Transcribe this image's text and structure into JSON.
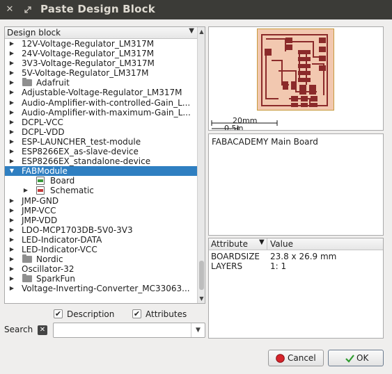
{
  "window": {
    "title": "Paste Design Block",
    "close_glyph": "✕",
    "close_icon": "close-icon",
    "maximize_icon": "maximize-icon"
  },
  "tree": {
    "header": "Design block",
    "items": [
      {
        "label": "12V-Voltage-Regulator_LM317M",
        "kind": "group"
      },
      {
        "label": "24V-Voltage-Regulator_LM317M",
        "kind": "group"
      },
      {
        "label": "3V3-Voltage-Regulator_LM317M",
        "kind": "group"
      },
      {
        "label": "5V-Voltage-Regulator_LM317M",
        "kind": "group"
      },
      {
        "label": "Adafruit",
        "kind": "folder"
      },
      {
        "label": "Adjustable-Voltage-Regulator_LM317M",
        "kind": "group"
      },
      {
        "label": "Audio-Amplifier-with-controlled-Gain_L...",
        "kind": "group"
      },
      {
        "label": "Audio-Amplifier-with-maximum-Gain_L...",
        "kind": "group"
      },
      {
        "label": "DCPL-VCC",
        "kind": "group"
      },
      {
        "label": "DCPL-VDD",
        "kind": "group"
      },
      {
        "label": "ESP-LAUNCHER_test-module",
        "kind": "group"
      },
      {
        "label": "ESP8266EX_as-slave-device",
        "kind": "group"
      },
      {
        "label": "ESP8266EX_standalone-device",
        "kind": "group"
      },
      {
        "label": "FABModule",
        "kind": "expanded",
        "selected": true
      },
      {
        "label": "Board",
        "kind": "board"
      },
      {
        "label": "Schematic",
        "kind": "schematic"
      },
      {
        "label": "JMP-GND",
        "kind": "group"
      },
      {
        "label": "JMP-VCC",
        "kind": "group"
      },
      {
        "label": "JMP-VDD",
        "kind": "group"
      },
      {
        "label": "LDO-MCP1703DB-5V0-3V3",
        "kind": "group"
      },
      {
        "label": "LED-Indicator-DATA",
        "kind": "group"
      },
      {
        "label": "LED-Indicator-VCC",
        "kind": "group"
      },
      {
        "label": "Nordic",
        "kind": "folder"
      },
      {
        "label": "Oscillator-32",
        "kind": "group"
      },
      {
        "label": "SparkFun",
        "kind": "folder"
      },
      {
        "label": "Voltage-Inverting-Converter_MC33063...",
        "kind": "group"
      }
    ]
  },
  "filters": {
    "description_label": "Description",
    "description_checked": true,
    "attributes_label": "Attributes",
    "attributes_checked": true
  },
  "search": {
    "label": "Search",
    "value": "",
    "placeholder": ""
  },
  "preview": {
    "scale_mm": "20mm",
    "scale_in": "0.5in"
  },
  "description": {
    "text": "FABACADEMY Main Board"
  },
  "attributes": {
    "col_attribute": "Attribute",
    "col_value": "Value",
    "rows": [
      {
        "name": "BOARDSIZE",
        "value": "23.8 x 26.9 mm"
      },
      {
        "name": "LAYERS",
        "value": "1: 1"
      }
    ]
  },
  "buttons": {
    "cancel": "Cancel",
    "ok": "OK"
  },
  "colors": {
    "titlebar": "#3b3b37",
    "selection": "#2f7fc1",
    "board_fill": "#f2c8b0",
    "board_outline": "#c79a3c",
    "copper": "#8b2a2a"
  }
}
